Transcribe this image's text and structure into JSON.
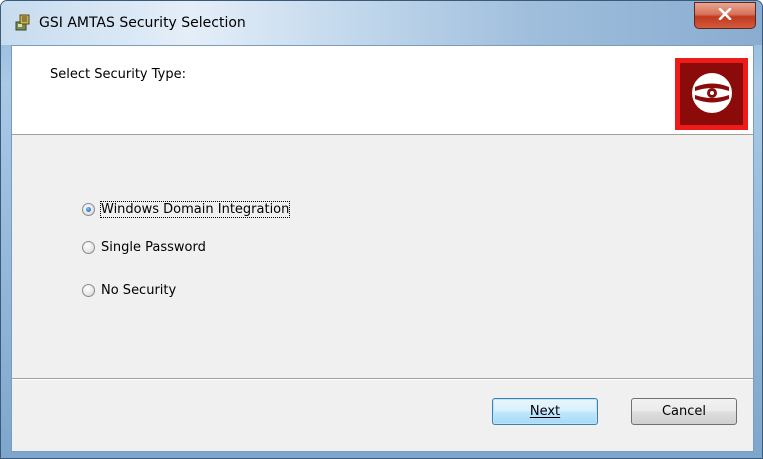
{
  "window": {
    "title": "GSI AMTAS Security Selection",
    "icon": "installer-icon",
    "close_icon": "close-icon"
  },
  "header": {
    "label": "Select Security Type:",
    "logo_icon": "disc-icon",
    "logo_color": "#ee1b1b"
  },
  "options": [
    {
      "label": "Windows Domain Integration",
      "selected": true
    },
    {
      "label": "Single Password",
      "selected": false
    },
    {
      "label": "No Security",
      "selected": false
    }
  ],
  "buttons": {
    "next_label": "Next",
    "cancel_label": "Cancel"
  }
}
